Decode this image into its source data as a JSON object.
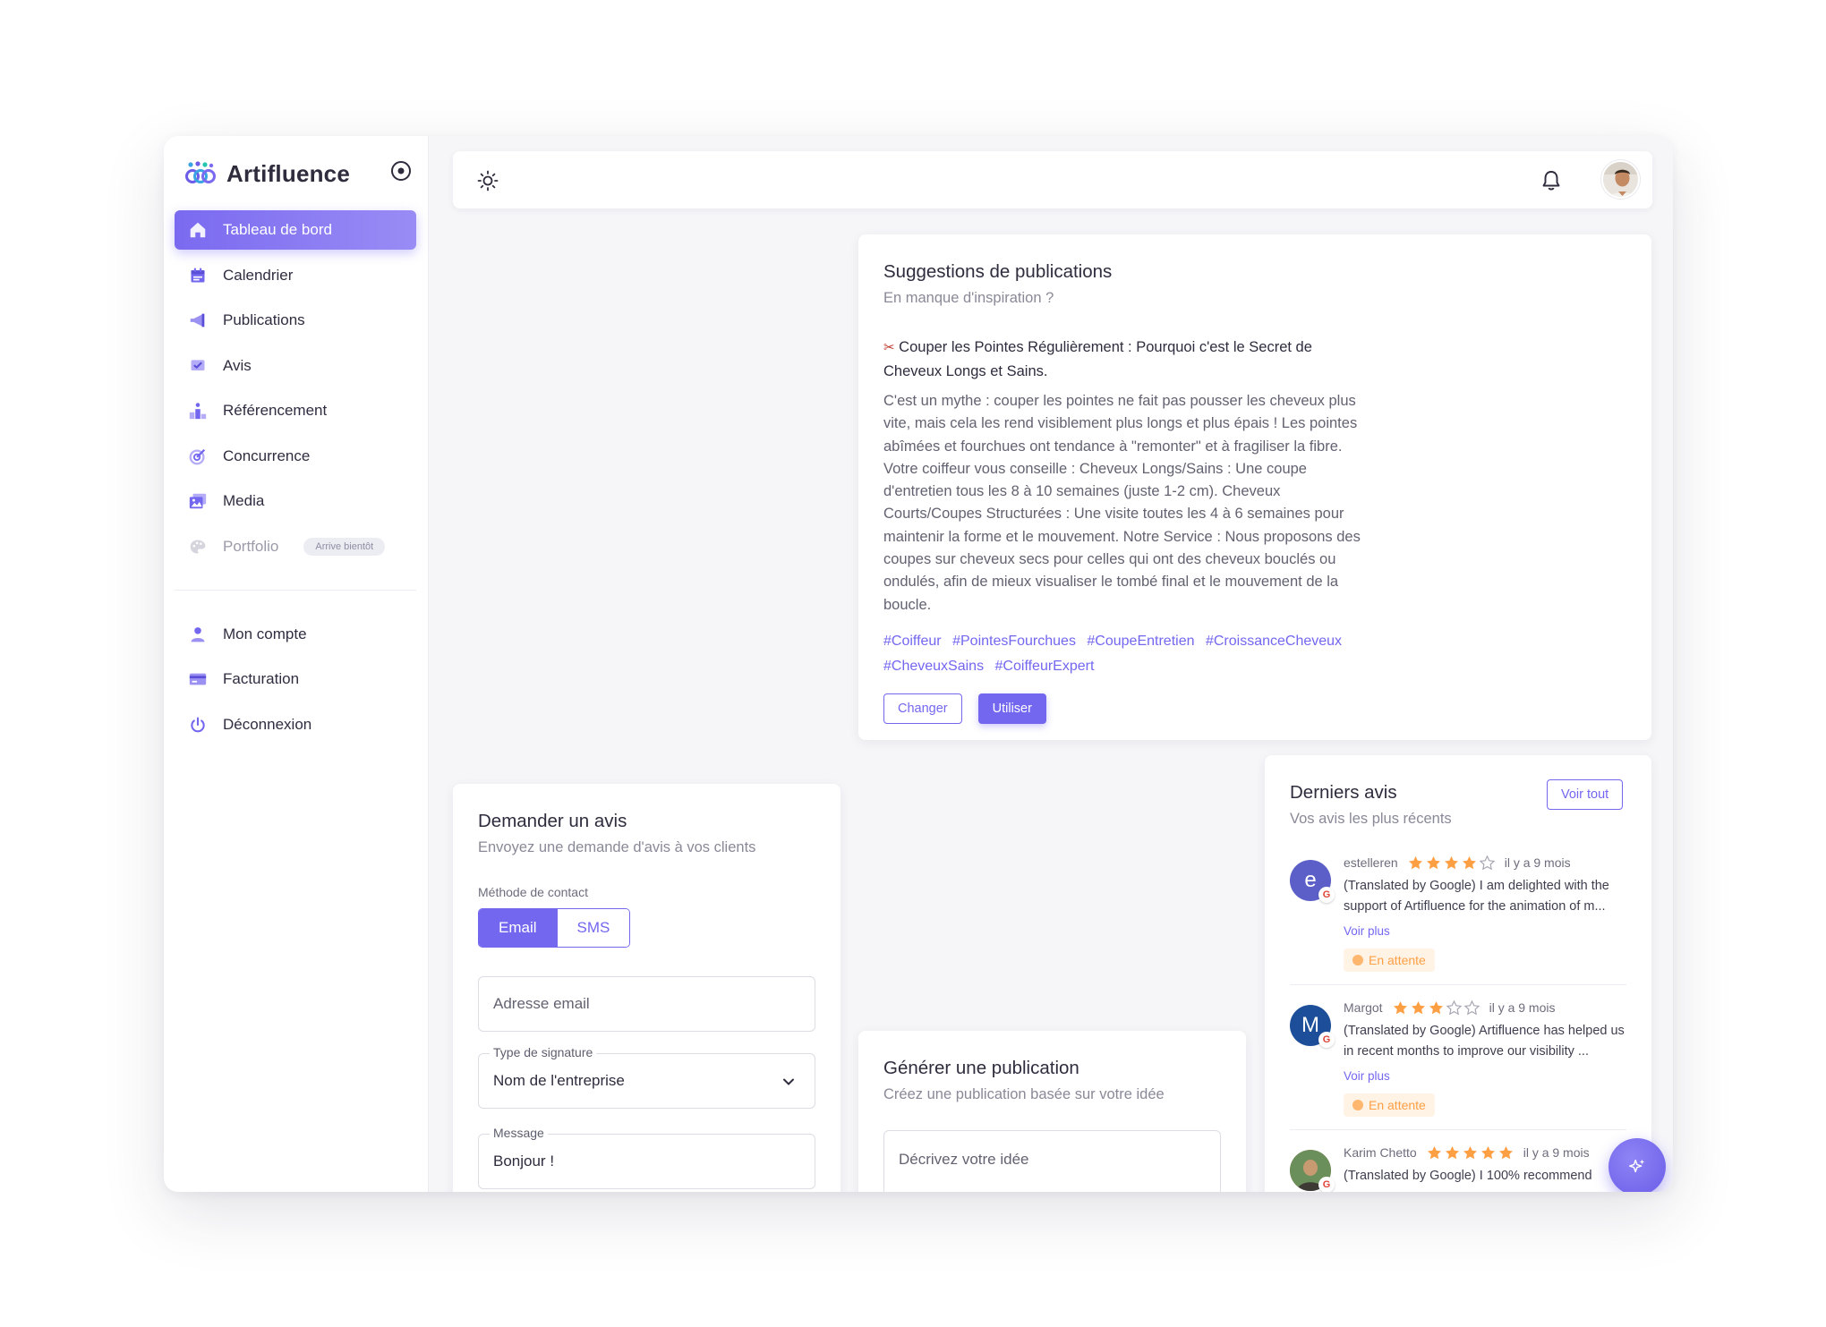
{
  "brand": {
    "name": "Artifluence"
  },
  "sidebar": {
    "items": [
      {
        "label": "Tableau de bord",
        "icon": "home-icon"
      },
      {
        "label": "Calendrier",
        "icon": "calendar-icon"
      },
      {
        "label": "Publications",
        "icon": "megaphone-icon"
      },
      {
        "label": "Avis",
        "icon": "review-check-icon"
      },
      {
        "label": "Référencement",
        "icon": "podium-icon"
      },
      {
        "label": "Concurrence",
        "icon": "target-icon"
      },
      {
        "label": "Media",
        "icon": "images-icon"
      },
      {
        "label": "Portfolio",
        "icon": "palette-icon",
        "badge": "Arrive bientôt"
      }
    ],
    "account_items": [
      {
        "label": "Mon compte",
        "icon": "user-icon"
      },
      {
        "label": "Facturation",
        "icon": "credit-card-icon"
      },
      {
        "label": "Déconnexion",
        "icon": "power-icon"
      }
    ]
  },
  "suggestions": {
    "title": "Suggestions de publications",
    "subtitle": "En manque d'inspiration ?",
    "post_title": "Couper les Pointes Régulièrement : Pourquoi c'est le Secret de Cheveux Longs et Sains.",
    "post_body": "C'est un mythe : couper les pointes ne fait pas pousser les cheveux plus vite, mais cela les rend visiblement plus longs et plus épais ! Les pointes abîmées et fourchues ont tendance à \"remonter\" et à fragiliser la fibre. Votre coiffeur vous conseille : Cheveux Longs/Sains : Une coupe d'entretien tous les 8 à 10 semaines (juste 1-2 cm). Cheveux Courts/Coupes Structurées : Une visite toutes les 4 à 6 semaines pour maintenir la forme et le mouvement. Notre Service : Nous proposons des coupes sur cheveux secs pour celles qui ont des cheveux bouclés ou ondulés, afin de mieux visualiser le tombé final et le mouvement de la boucle.",
    "hashtags": [
      "#Coiffeur",
      "#PointesFourchues",
      "#CoupeEntretien",
      "#CroissanceCheveux",
      "#CheveuxSains",
      "#CoiffeurExpert"
    ],
    "btn_change": "Changer",
    "btn_use": "Utiliser"
  },
  "request_review": {
    "title": "Demander un avis",
    "subtitle": "Envoyez une demande d'avis à vos clients",
    "contact_label": "Méthode de contact",
    "opt_email": "Email",
    "opt_sms": "SMS",
    "email_placeholder": "Adresse email",
    "signature_label": "Type de signature",
    "signature_value": "Nom de l'entreprise",
    "message_label": "Message",
    "message_value": "Bonjour !"
  },
  "generate": {
    "title": "Générer une publication",
    "subtitle": "Créez une publication basée sur votre idée",
    "placeholder": "Décrivez votre idée"
  },
  "reviews": {
    "title": "Derniers avis",
    "subtitle": "Vos avis les plus récents",
    "see_all": "Voir tout",
    "items": [
      {
        "author": "estelleren",
        "initial": "e",
        "avatar_color": "#5b5fc7",
        "rating": 4,
        "time": "il y a 9 mois",
        "text": "(Translated by Google) I am delighted with the support of Artifluence for the animation of m...",
        "more": "Voir plus",
        "status": "En attente"
      },
      {
        "author": "Margot",
        "initial": "M",
        "avatar_color": "#1d4e9a",
        "rating": 3,
        "time": "il y a 9 mois",
        "text": "(Translated by Google) Artifluence has helped us in recent months to improve our visibility ...",
        "more": "Voir plus",
        "status": "En attente"
      },
      {
        "author": "Karim Chetto",
        "initial": "",
        "avatar_color": "#8a6a4a",
        "rating": 5,
        "time": "il y a 9 mois",
        "text": "(Translated by Google) I 100% recommend",
        "more": "",
        "status": ""
      }
    ]
  },
  "colors": {
    "accent": "#7367f0",
    "star": "#ff9f43",
    "pending_bg": "#fff3e6"
  }
}
